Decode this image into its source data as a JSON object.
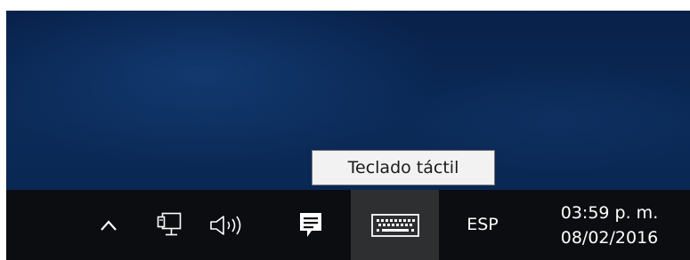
{
  "tooltip": {
    "text": "Teclado táctil"
  },
  "taskbar": {
    "tray_icons": [
      {
        "name": "chevron-up-icon",
        "label": "show hidden icons"
      },
      {
        "name": "network-icon",
        "label": "network"
      },
      {
        "name": "volume-icon",
        "label": "volume"
      },
      {
        "name": "action-center-icon",
        "label": "notifications"
      },
      {
        "name": "keyboard-icon",
        "label": "touch keyboard"
      }
    ],
    "language": "ESP",
    "time": "03:59 p. m.",
    "date": "08/02/2016"
  },
  "colors": {
    "desktop": "#0b2a57",
    "taskbar": "#0b0d10",
    "taskbar_hover": "#2e2f31",
    "tooltip_bg": "#f2f2f2",
    "tooltip_border": "#767676"
  }
}
